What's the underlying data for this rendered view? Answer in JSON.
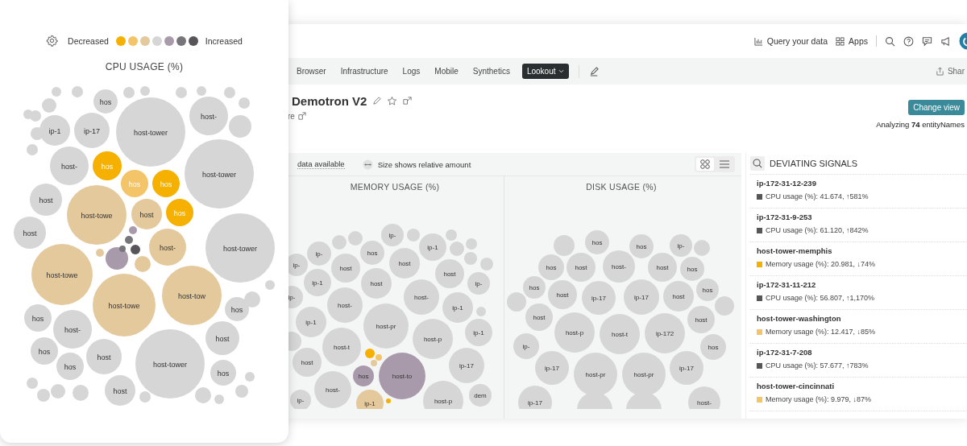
{
  "card": {
    "legend": {
      "low_label": "Decreased",
      "high_label": "Increased",
      "colors": [
        {
          "color": "#f5b000"
        },
        {
          "color": "#f3c468"
        },
        {
          "color": "#e4c99d"
        },
        {
          "color": "#d6d6d6"
        },
        {
          "color": "#a99aab"
        },
        {
          "color": "#77757a"
        },
        {
          "color": "#58555a"
        }
      ]
    },
    "chart": {
      "title": "CPU USAGE (%)",
      "bubbles": [
        {
          "label": "hos",
          "color": "#d6d6d6"
        },
        {
          "label": "ip-1",
          "color": "#d6d6d6"
        },
        {
          "label": "ip-17",
          "color": "#d6d6d6"
        },
        {
          "label": "host-tower",
          "color": "#d6d6d6"
        },
        {
          "label": "host-",
          "color": "#d6d6d6"
        },
        {
          "label": "host-",
          "color": "#d6d6d6"
        },
        {
          "label": "hos",
          "color": "#f5b000"
        },
        {
          "label": "hos",
          "color": "#f3c468"
        },
        {
          "label": "hos",
          "color": "#f5b000"
        },
        {
          "label": "host",
          "color": "#d6d6d6"
        },
        {
          "label": "host-tower",
          "color": "#d6d6d6"
        },
        {
          "label": "host-towe",
          "color": "#e4c99d"
        },
        {
          "label": "host",
          "color": "#e4c99d"
        },
        {
          "label": "hos",
          "color": "#f5b000"
        },
        {
          "label": "host",
          "color": "#d6d6d6"
        },
        {
          "color": "#a99aab"
        },
        {
          "label": "host-",
          "color": "#e4c99d"
        },
        {
          "label": "host-tower",
          "color": "#d6d6d6"
        },
        {
          "label": "host-towe",
          "color": "#e4c99d"
        },
        {
          "label": "host-towe",
          "color": "#e4c99d"
        },
        {
          "label": "host-tow",
          "color": "#e4c99d"
        },
        {
          "label": "hos",
          "color": "#d6d6d6"
        },
        {
          "label": "hos",
          "color": "#d6d6d6"
        },
        {
          "label": "host-",
          "color": "#d6d6d6"
        },
        {
          "label": "host",
          "color": "#d6d6d6"
        },
        {
          "label": "hos",
          "color": "#d6d6d6"
        },
        {
          "label": "host",
          "color": "#d6d6d6"
        },
        {
          "label": "host-tower",
          "color": "#d6d6d6"
        },
        {
          "label": "hos",
          "color": "#d6d6d6"
        },
        {
          "label": "hos",
          "color": "#d6d6d6"
        },
        {
          "label": "host",
          "color": "#d6d6d6"
        },
        {
          "color": "#77757a"
        },
        {
          "color": "#58555a"
        },
        {
          "color": "#a99aab"
        },
        {
          "color": "#77757a"
        },
        {
          "color": "#e4c99d"
        },
        {
          "color": "#e4c99d"
        },
        {
          "color": "#d6d6d6"
        },
        {
          "color": "#d6d6d6"
        },
        {
          "color": "#d6d6d6"
        },
        {
          "color": "#d6d6d6"
        },
        {
          "color": "#d6d6d6"
        },
        {
          "color": "#d6d6d6"
        },
        {
          "color": "#d6d6d6"
        },
        {
          "color": "#d6d6d6"
        },
        {
          "color": "#d6d6d6"
        },
        {
          "color": "#d6d6d6"
        },
        {
          "color": "#d6d6d6"
        },
        {
          "color": "#d6d6d6"
        },
        {
          "color": "#d6d6d6"
        },
        {
          "color": "#d6d6d6"
        },
        {
          "color": "#d6d6d6"
        },
        {
          "color": "#d6d6d6"
        },
        {
          "color": "#d6d6d6"
        },
        {
          "color": "#d6d6d6"
        },
        {
          "color": "#d6d6d6"
        },
        {
          "color": "#d6d6d6"
        },
        {
          "color": "#d6d6d6"
        },
        {
          "color": "#d6d6d6"
        },
        {
          "color": "#d6d6d6"
        },
        {
          "color": "#d6d6d6"
        },
        {
          "color": "#d6d6d6"
        }
      ]
    }
  },
  "topbar": {
    "items": [
      {
        "kind": "chart",
        "label": "Query your data"
      },
      {
        "kind": "grid",
        "label": "Apps"
      }
    ]
  },
  "nav": {
    "tabs": [
      {
        "label": "Browser",
        "selected": false
      },
      {
        "label": "Infrastructure",
        "selected": false
      },
      {
        "label": "Logs",
        "selected": false
      },
      {
        "label": "Mobile",
        "selected": false
      },
      {
        "label": "Synthetics",
        "selected": false
      },
      {
        "label": "Lookout",
        "selected": true
      }
    ],
    "share": "Shar"
  },
  "header": {
    "title": "Demotron V2",
    "link": "re",
    "button": "Change view",
    "summary": "Analyzing **74** entityNames"
  },
  "toolbar": {
    "note": "data available",
    "size_note": "Size shows relative amount"
  },
  "charts": [
    {
      "title": "MEMORY USAGE (%)",
      "bubbles": [
        {
          "label": "ip-",
          "color": "#d6d6d6"
        },
        {
          "label": "ip-",
          "color": "#d6d6d6"
        },
        {
          "label": "ip-",
          "color": "#d6d6d6"
        },
        {
          "label": "hos",
          "color": "#d6d6d6"
        },
        {
          "label": "host",
          "color": "#d6d6d6"
        },
        {
          "label": "ip-1",
          "color": "#d6d6d6"
        },
        {
          "label": "host",
          "color": "#d6d6d6"
        },
        {
          "label": "host",
          "color": "#d6d6d6"
        },
        {
          "label": "ip-1",
          "color": "#d6d6d6"
        },
        {
          "label": "host",
          "color": "#d6d6d6"
        },
        {
          "label": "ip-",
          "color": "#d6d6d6"
        },
        {
          "label": "ip-",
          "color": "#d6d6d6"
        },
        {
          "label": "host-",
          "color": "#d6d6d6"
        },
        {
          "label": "host-",
          "color": "#d6d6d6"
        },
        {
          "label": "ip-1",
          "color": "#d6d6d6"
        },
        {
          "label": "ip-1",
          "color": "#d6d6d6"
        },
        {
          "label": "host-pr",
          "color": "#d6d6d6"
        },
        {
          "label": "host-p",
          "color": "#d6d6d6"
        },
        {
          "label": "ip-1",
          "color": "#d6d6d6"
        },
        {
          "label": "host-t",
          "color": "#d6d6d6"
        },
        {
          "label": "host",
          "color": "#d6d6d6"
        },
        {
          "label": "ip-17",
          "color": "#d6d6d6"
        },
        {
          "label": "hos",
          "color": "#a99aab"
        },
        {
          "label": "host-to",
          "color": "#a99aab"
        },
        {
          "label": "host-",
          "color": "#d6d6d6"
        },
        {
          "label": "ip-",
          "color": "#d6d6d6"
        },
        {
          "label": "ip-1",
          "color": "#e4c99d"
        },
        {
          "label": "host-p",
          "color": "#d6d6d6"
        },
        {
          "label": "dem",
          "color": "#d6d6d6"
        },
        {
          "color": "#f5b000"
        },
        {
          "color": "#f3c468"
        },
        {
          "color": "#e4c99d"
        },
        {
          "color": "#f5b000"
        },
        {
          "color": "#d6d6d6"
        },
        {
          "color": "#d6d6d6"
        },
        {
          "color": "#d6d6d6"
        },
        {
          "color": "#d6d6d6"
        },
        {
          "color": "#d6d6d6"
        },
        {
          "color": "#d6d6d6"
        },
        {
          "color": "#d6d6d6"
        },
        {
          "color": "#d6d6d6"
        },
        {
          "color": "#d6d6d6"
        },
        {
          "color": "#d6d6d6"
        }
      ]
    },
    {
      "title": "DISK USAGE (%)",
      "bubbles": [
        {
          "label": "hos",
          "color": "#d6d6d6"
        },
        {
          "label": "hos",
          "color": "#d6d6d6"
        },
        {
          "label": "ip-",
          "color": "#d6d6d6"
        },
        {
          "color": "#d6d6d6"
        },
        {
          "color": "#d6d6d6"
        },
        {
          "label": "hos",
          "color": "#d6d6d6"
        },
        {
          "label": "host",
          "color": "#d6d6d6"
        },
        {
          "label": "host-",
          "color": "#d6d6d6"
        },
        {
          "label": "host",
          "color": "#d6d6d6"
        },
        {
          "label": "hos",
          "color": "#d6d6d6"
        },
        {
          "label": "hos",
          "color": "#d6d6d6"
        },
        {
          "label": "host",
          "color": "#d6d6d6"
        },
        {
          "label": "ip-17",
          "color": "#d6d6d6"
        },
        {
          "label": "ip-17",
          "color": "#d6d6d6"
        },
        {
          "label": "host",
          "color": "#d6d6d6"
        },
        {
          "label": "hos",
          "color": "#d6d6d6"
        },
        {
          "color": "#d6d6d6"
        },
        {
          "color": "#d6d6d6"
        },
        {
          "label": "host",
          "color": "#d6d6d6"
        },
        {
          "label": "host-p",
          "color": "#d6d6d6"
        },
        {
          "label": "host-t",
          "color": "#d6d6d6"
        },
        {
          "label": "ip-172",
          "color": "#d6d6d6"
        },
        {
          "label": "host",
          "color": "#d6d6d6"
        },
        {
          "label": "ip-",
          "color": "#d6d6d6"
        },
        {
          "label": "hos",
          "color": "#d6d6d6"
        },
        {
          "label": "ip-17",
          "color": "#d6d6d6"
        },
        {
          "label": "host-pr",
          "color": "#d6d6d6"
        },
        {
          "label": "host-pr",
          "color": "#d6d6d6"
        },
        {
          "label": "ip-17",
          "color": "#d6d6d6"
        },
        {
          "label": "ip-17",
          "color": "#d6d6d6"
        },
        {
          "label": "host-",
          "color": "#d6d6d6"
        },
        {
          "color": "#d6d6d6"
        },
        {
          "color": "#d6d6d6"
        }
      ]
    }
  ],
  "signals": {
    "title": "DEVIATING SIGNALS",
    "items": [
      {
        "name": "ip-172-31-12-239",
        "metric": "CPU usage (%): 41.674, ↑581%",
        "color": "#58555a"
      },
      {
        "name": "ip-172-31-9-253",
        "metric": "CPU usage (%): 61.120, ↑842%",
        "color": "#58555a"
      },
      {
        "name": "host-tower-memphis",
        "metric": "Memory usage (%): 20.981, ↓74%",
        "color": "#f5b000"
      },
      {
        "name": "ip-172-31-11-212",
        "metric": "CPU usage (%): 56.807, ↑1,170%",
        "color": "#58555a"
      },
      {
        "name": "host-tower-washington",
        "metric": "Memory usage (%): 12.417, ↓85%",
        "color": "#f3c468"
      },
      {
        "name": "ip-172-31-7-208",
        "metric": "CPU usage (%): 57.677, ↑783%",
        "color": "#58555a"
      },
      {
        "name": "host-tower-cincinnati",
        "metric": "Memory usage (%): 9.979, ↓87%",
        "color": "#f3c468"
      }
    ]
  }
}
